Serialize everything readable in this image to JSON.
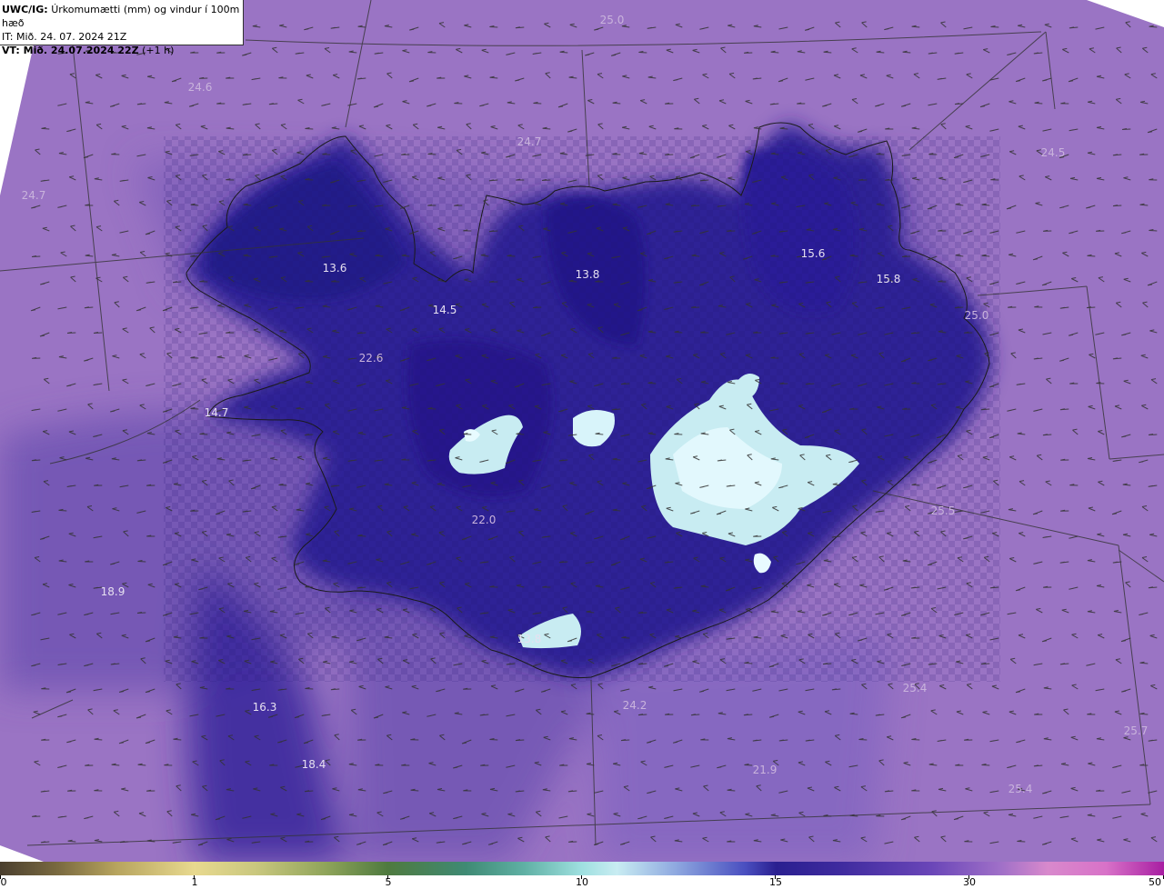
{
  "header": {
    "line1_bold": "UWC/IG:",
    "line1_text": "Úrkomumætti (mm) og vindur í 100m hæð",
    "line2": "IT: Mið. 24. 07. 2024 21Z",
    "line3_bold": "VT: Mið. 24.07.2024 22Z",
    "line3_text": "(+1 h)"
  },
  "map_values": [
    "25.0",
    "24.6",
    "24.7",
    "24.7",
    "24.5",
    "13.6",
    "13.8",
    "15.6",
    "15.8",
    "14.5",
    "25.0",
    "22.6",
    "14.7",
    "22.0",
    "25.5",
    "18.9",
    "13.8",
    "16.3",
    "24.2",
    "25.4",
    "18.4",
    "21.9",
    "25.7",
    "25.4"
  ],
  "colorbar": {
    "ticks": [
      "0",
      "1",
      "5",
      "10",
      "15",
      "30",
      "50"
    ]
  },
  "colors": {
    "background_field": "#9a74c4",
    "high_field": "#2a1f90",
    "ice_highlight": "#c8ecf2",
    "coastline": "#1a1a1a"
  }
}
